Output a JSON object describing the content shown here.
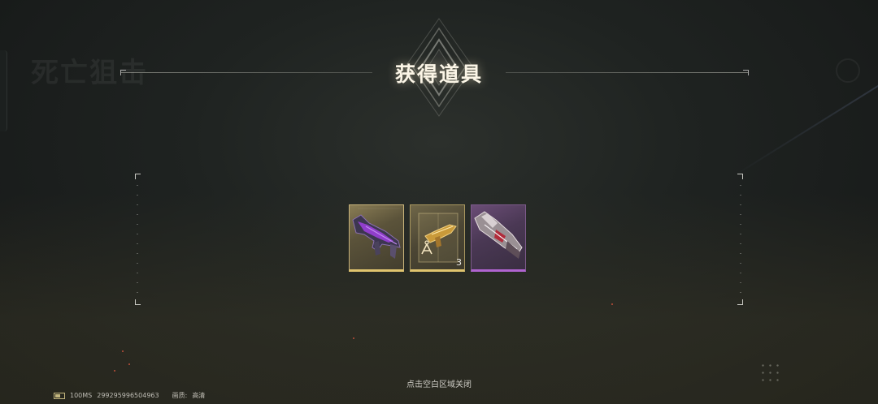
{
  "header": {
    "title": "获得道具",
    "ghost_title": "死亡狙击"
  },
  "rewards": [
    {
      "name": "purple-sniper-rifle",
      "rarity": "gold",
      "quantity": ""
    },
    {
      "name": "rifle-crate",
      "rarity": "gold",
      "quantity": "3"
    },
    {
      "name": "heavy-weapon",
      "rarity": "purple",
      "quantity": ""
    }
  ],
  "footer": {
    "hint": "点击空白区域关闭",
    "ping": "100MS",
    "player_id": "299295996504963",
    "quality_label": "画质:",
    "quality_value": "高清"
  },
  "colors": {
    "gold_border": "#e0c46e",
    "purple_border": "#b064d0",
    "title_text": "#fbf5e6"
  }
}
